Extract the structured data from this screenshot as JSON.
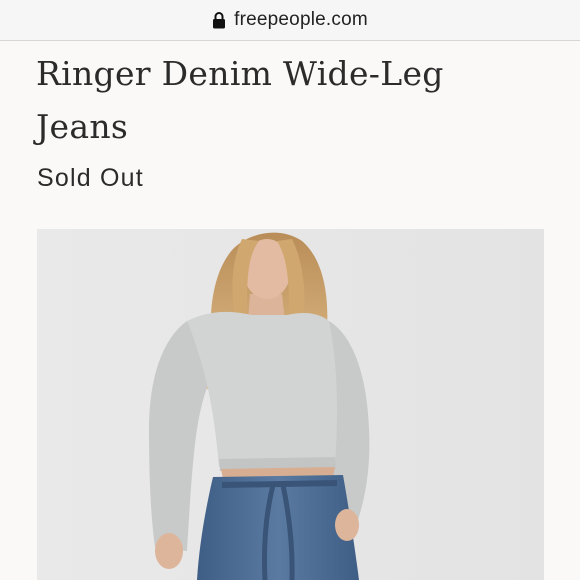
{
  "browser": {
    "url": "freepeople.com",
    "lock_icon": "lock-icon"
  },
  "product": {
    "title": "Ringer Denim Wide-Leg Jeans",
    "status": "Sold Out",
    "image_subject": "model-wearing-grey-cropped-sweater-and-blue-wide-leg-jeans"
  },
  "colors": {
    "page_background": "#fbf9f8",
    "photo_background": "#e6e6e6",
    "sweater": "#cfd1d0",
    "denim": "#4d6c93",
    "hair": "#c9a068"
  }
}
